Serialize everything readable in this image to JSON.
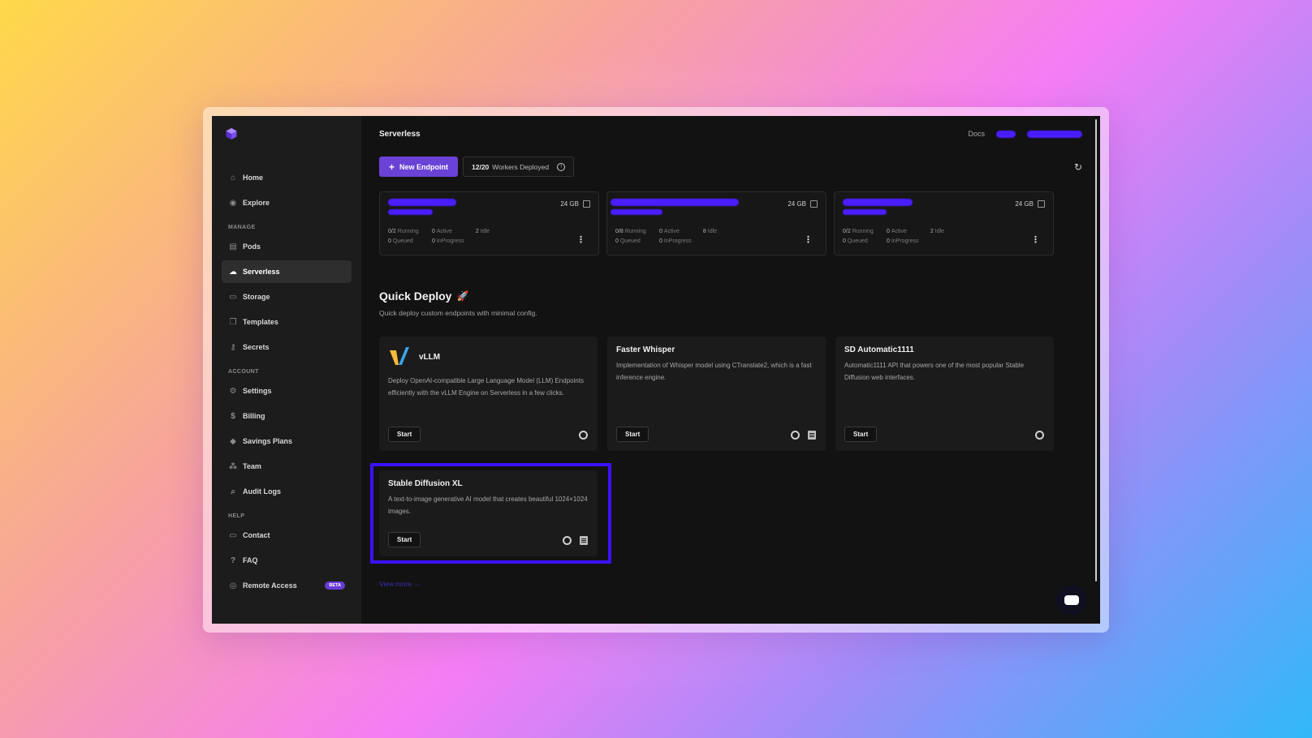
{
  "sidebar": {
    "items_top": [
      {
        "label": "Home",
        "icon": "home-icon"
      },
      {
        "label": "Explore",
        "icon": "compass-icon"
      }
    ],
    "manage_label": "MANAGE",
    "items_manage": [
      {
        "label": "Pods",
        "icon": "pods-icon"
      },
      {
        "label": "Serverless",
        "icon": "cloud-icon"
      },
      {
        "label": "Storage",
        "icon": "folder-icon"
      },
      {
        "label": "Templates",
        "icon": "template-icon"
      },
      {
        "label": "Secrets",
        "icon": "key-icon"
      }
    ],
    "account_label": "ACCOUNT",
    "items_account": [
      {
        "label": "Settings",
        "icon": "gear-icon"
      },
      {
        "label": "Billing",
        "icon": "billing-icon"
      },
      {
        "label": "Savings Plans",
        "icon": "tag-icon"
      },
      {
        "label": "Team",
        "icon": "team-icon"
      },
      {
        "label": "Audit Logs",
        "icon": "audit-icon"
      }
    ],
    "help_label": "HELP",
    "items_help": [
      {
        "label": "Contact",
        "icon": "chat-icon"
      },
      {
        "label": "FAQ",
        "icon": "faq-icon"
      },
      {
        "label": "Remote Access",
        "icon": "remote-icon",
        "badge": "BETA"
      }
    ]
  },
  "header": {
    "title": "Serverless",
    "docs_label": "Docs"
  },
  "toolbar": {
    "new_endpoint_label": "New Endpoint",
    "workers_count": "12/20",
    "workers_label": "Workers Deployed"
  },
  "endpoints": [
    {
      "gpu": "24 GB",
      "running": "0/2",
      "running_label": "Running",
      "active": "0",
      "active_label": "Active",
      "idle": "2",
      "idle_label": "Idle",
      "queued": "0",
      "queued_label": "Queued",
      "inprogress": "0",
      "inprogress_label": "InProgress"
    },
    {
      "gpu": "24 GB",
      "running": "0/8",
      "running_label": "Running",
      "active": "0",
      "active_label": "Active",
      "idle": "8",
      "idle_label": "Idle",
      "queued": "0",
      "queued_label": "Queued",
      "inprogress": "0",
      "inprogress_label": "InProgress"
    },
    {
      "gpu": "24 GB",
      "running": "0/2",
      "running_label": "Running",
      "active": "0",
      "active_label": "Active",
      "idle": "2",
      "idle_label": "Idle",
      "queued": "0",
      "queued_label": "Queued",
      "inprogress": "0",
      "inprogress_label": "InProgress"
    }
  ],
  "quick_deploy": {
    "title": "Quick Deploy",
    "subtitle": "Quick deploy custom endpoints with minimal config.",
    "cards": [
      {
        "name": "vLLM",
        "desc": "Deploy OpenAI-compatible Large Language Model (LLM) Endpoints efficiently with the vLLM Engine on Serverless in a few clicks.",
        "start": "Start"
      },
      {
        "name": "Faster Whisper",
        "desc": "Implementation of Whisper model using CTranslate2, which is a fast inference engine.",
        "start": "Start"
      },
      {
        "name": "SD Automatic1111",
        "desc": "Automatic1111 API that powers one of the most popular Stable Diffusion web interfaces.",
        "start": "Start"
      },
      {
        "name": "Stable Diffusion XL",
        "desc": "A text-to-image generative AI model that creates beautiful 1024×1024 images.",
        "start": "Start"
      }
    ],
    "view_more": "View more →"
  },
  "colors": {
    "accent": "#6a42d6",
    "highlight": "#3b10ff",
    "redaction": "#4a1dff"
  }
}
